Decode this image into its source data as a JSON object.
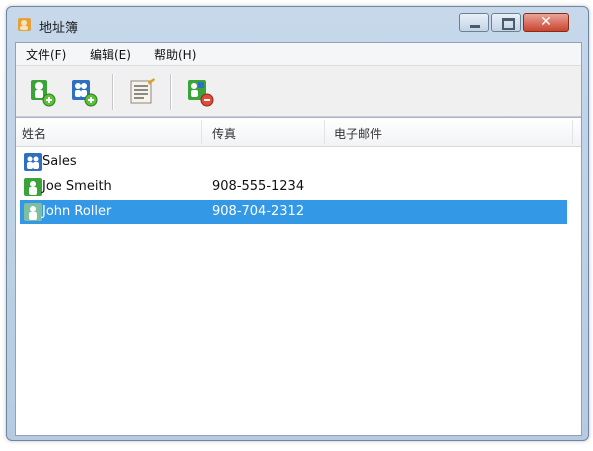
{
  "window": {
    "title": "地址簿"
  },
  "menu": [
    {
      "label": "文件(F)"
    },
    {
      "label": "编辑(E)"
    },
    {
      "label": "帮助(H)"
    }
  ],
  "toolbar": {
    "buttons": [
      {
        "icon": "new-contact-icon"
      },
      {
        "icon": "new-group-icon"
      },
      {
        "icon": "properties-icon"
      },
      {
        "icon": "delete-icon"
      }
    ]
  },
  "columns": [
    "姓名",
    "传真",
    "电子邮件"
  ],
  "rows": [
    {
      "name": "Sales",
      "fax": "",
      "email": "",
      "type": "group"
    },
    {
      "name": "Joe Smeith",
      "fax": "908-555-1234",
      "email": "",
      "type": "contact"
    },
    {
      "name": "John Roller",
      "fax": "908-704-2312",
      "email": "",
      "type": "contact",
      "selected": true
    }
  ],
  "colors": {
    "selection": "#3399e6",
    "contact_icon": "#3aa33a",
    "group_icon": "#2f6fbf"
  }
}
